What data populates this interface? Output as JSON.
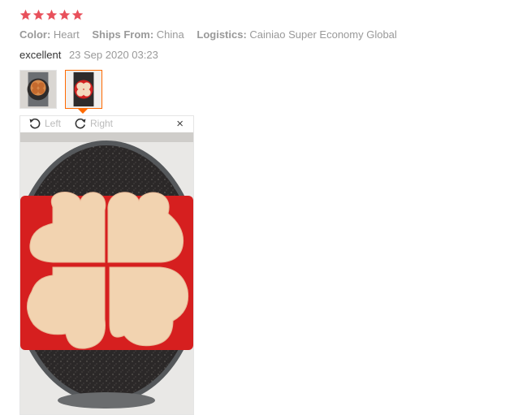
{
  "review": {
    "rating": 5,
    "star_color": "#e8505b",
    "attributes": [
      {
        "key": "Color:",
        "value": "Heart"
      },
      {
        "key": "Ships From:",
        "value": "China"
      },
      {
        "key": "Logistics:",
        "value": "Cainiao Super Economy Global"
      }
    ],
    "text": "excellent",
    "date": "23 Sep 2020 03:23"
  },
  "gallery": {
    "accent": "#ff6a00",
    "selected_index": 1,
    "thumbnails": [
      {
        "icon": "pancake-pan-photo"
      },
      {
        "icon": "heart-pancake-photo"
      }
    ]
  },
  "viewer": {
    "rotate_left_label": "Left",
    "rotate_right_label": "Right",
    "close_glyph": "×"
  }
}
